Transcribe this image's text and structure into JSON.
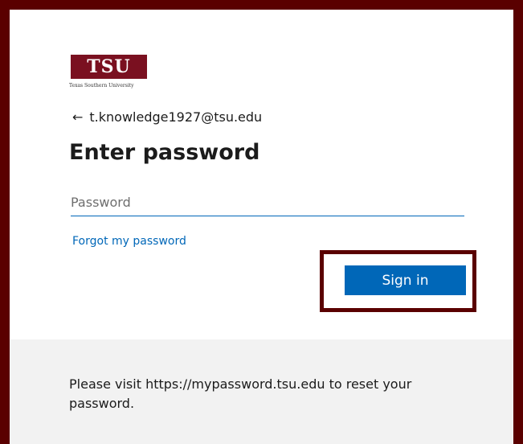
{
  "logo": {
    "text": "TSU",
    "subtitle": "Texas Southern University",
    "brand_color": "#7a1020"
  },
  "identity": {
    "back_icon": "←",
    "email": "t.knowledge1927@tsu.edu"
  },
  "title": "Enter password",
  "password_field": {
    "placeholder": "Password",
    "value": ""
  },
  "forgot_link": "Forgot my password",
  "signin_button": "Sign in",
  "footer": {
    "text": "Please visit https://mypassword.tsu.edu to reset your password."
  },
  "colors": {
    "accent": "#0067b8",
    "frame": "#5a0000",
    "footer_bg": "#f2f2f2"
  }
}
